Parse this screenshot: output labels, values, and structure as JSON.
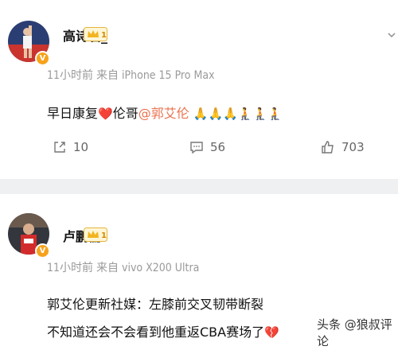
{
  "posts": [
    {
      "username": "高诗岩_",
      "time": "11小时前",
      "source": "来自 iPhone 15 Pro Max",
      "text_prefix": "早日康复",
      "heart": "❤️",
      "text_mid": "伦哥",
      "mention": "@郭艾伦",
      "emojis": "🙏🙏🙏🧎🧎🧎",
      "actions": {
        "share_count": "10",
        "comment_count": "56",
        "like_count": "703"
      }
    },
    {
      "username": "卢鹏儒",
      "time": "11小时前",
      "source": "来自 vivo X200 Ultra",
      "line1": "郭艾伦更新社媒：左膝前交叉韧带断裂",
      "line2": "不知道还会不会看到他重返CBA赛场了",
      "broken_heart": "💔"
    }
  ],
  "watermark": "头条 @狼叔评论"
}
